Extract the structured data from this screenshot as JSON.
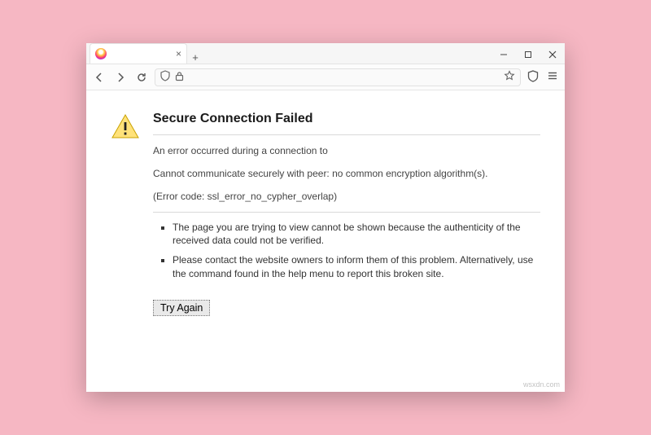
{
  "window": {
    "tab": {
      "title": ""
    }
  },
  "error": {
    "title": "Secure Connection Failed",
    "line1": "An error occurred during a connection to",
    "line2": "Cannot communicate securely with peer: no common encryption algorithm(s).",
    "code": "(Error code: ssl_error_no_cypher_overlap)",
    "bullets": [
      "The page you are trying to view cannot be shown because the authenticity of the received data could not be verified.",
      "Please contact the website owners to inform them of this problem. Alternatively, use the command found in the help menu to report this broken site."
    ],
    "try_again": "Try Again"
  },
  "watermark": "wsxdn.com"
}
